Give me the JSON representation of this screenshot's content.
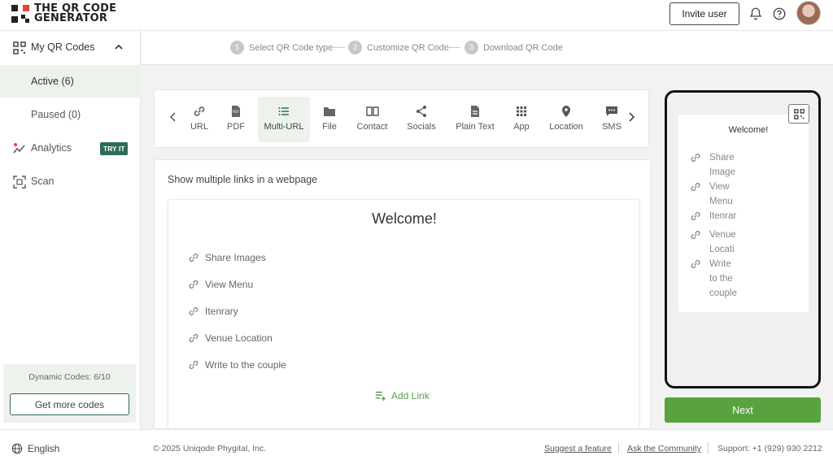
{
  "header": {
    "logo_line1": "THE QR CODE",
    "logo_line2": "GENERATOR",
    "invite_label": "Invite user"
  },
  "sidebar": {
    "my_qr_codes": "My QR Codes",
    "active": "Active (6)",
    "paused": "Paused (0)",
    "analytics": "Analytics",
    "try_it": "TRY IT",
    "scan": "Scan",
    "dynamic_codes": "Dynamic Codes: 6/10",
    "get_more": "Get more codes"
  },
  "steps": [
    {
      "num": "1",
      "label": "Select QR Code type"
    },
    {
      "num": "2",
      "label": "Customize QR Code"
    },
    {
      "num": "3",
      "label": "Download QR Code"
    }
  ],
  "types": [
    {
      "label": "URL",
      "icon": "link-icon"
    },
    {
      "label": "PDF",
      "icon": "pdf-icon"
    },
    {
      "label": "Multi-URL",
      "icon": "list-icon",
      "selected": true
    },
    {
      "label": "File",
      "icon": "folder-icon"
    },
    {
      "label": "Contact",
      "icon": "contact-book-icon"
    },
    {
      "label": "Socials",
      "icon": "share-icon"
    },
    {
      "label": "Plain Text",
      "icon": "document-icon"
    },
    {
      "label": "App",
      "icon": "app-grid-icon"
    },
    {
      "label": "Location",
      "icon": "location-pin-icon"
    },
    {
      "label": "SMS",
      "icon": "sms-icon"
    }
  ],
  "main": {
    "description": "Show multiple links in a webpage",
    "welcome": "Welcome!",
    "links": [
      "Share Images",
      "View Menu",
      "Itenrary",
      "Venue Location",
      "Write to the couple"
    ],
    "add_link": "Add Link"
  },
  "preview": {
    "welcome": "Welcome!",
    "links": [
      {
        "lines": [
          "Share",
          "Image"
        ]
      },
      {
        "lines": [
          "View",
          "Menu"
        ]
      },
      {
        "lines": [
          "Itenrar"
        ]
      },
      {
        "lines": [
          "Venue",
          "Locati"
        ]
      },
      {
        "lines": [
          "Write",
          "to the",
          "couple"
        ]
      }
    ],
    "next": "Next"
  },
  "footer": {
    "language": "English",
    "copyright": "© 2025 Uniqode Phygital, Inc.",
    "suggest": "Suggest a feature",
    "community": "Ask the Community",
    "support": "Support:  +1 (929) 930 2212"
  },
  "colors": {
    "accent_green": "#58a33f",
    "dark_green": "#2f6b57",
    "active_bg": "#eef2ec"
  }
}
